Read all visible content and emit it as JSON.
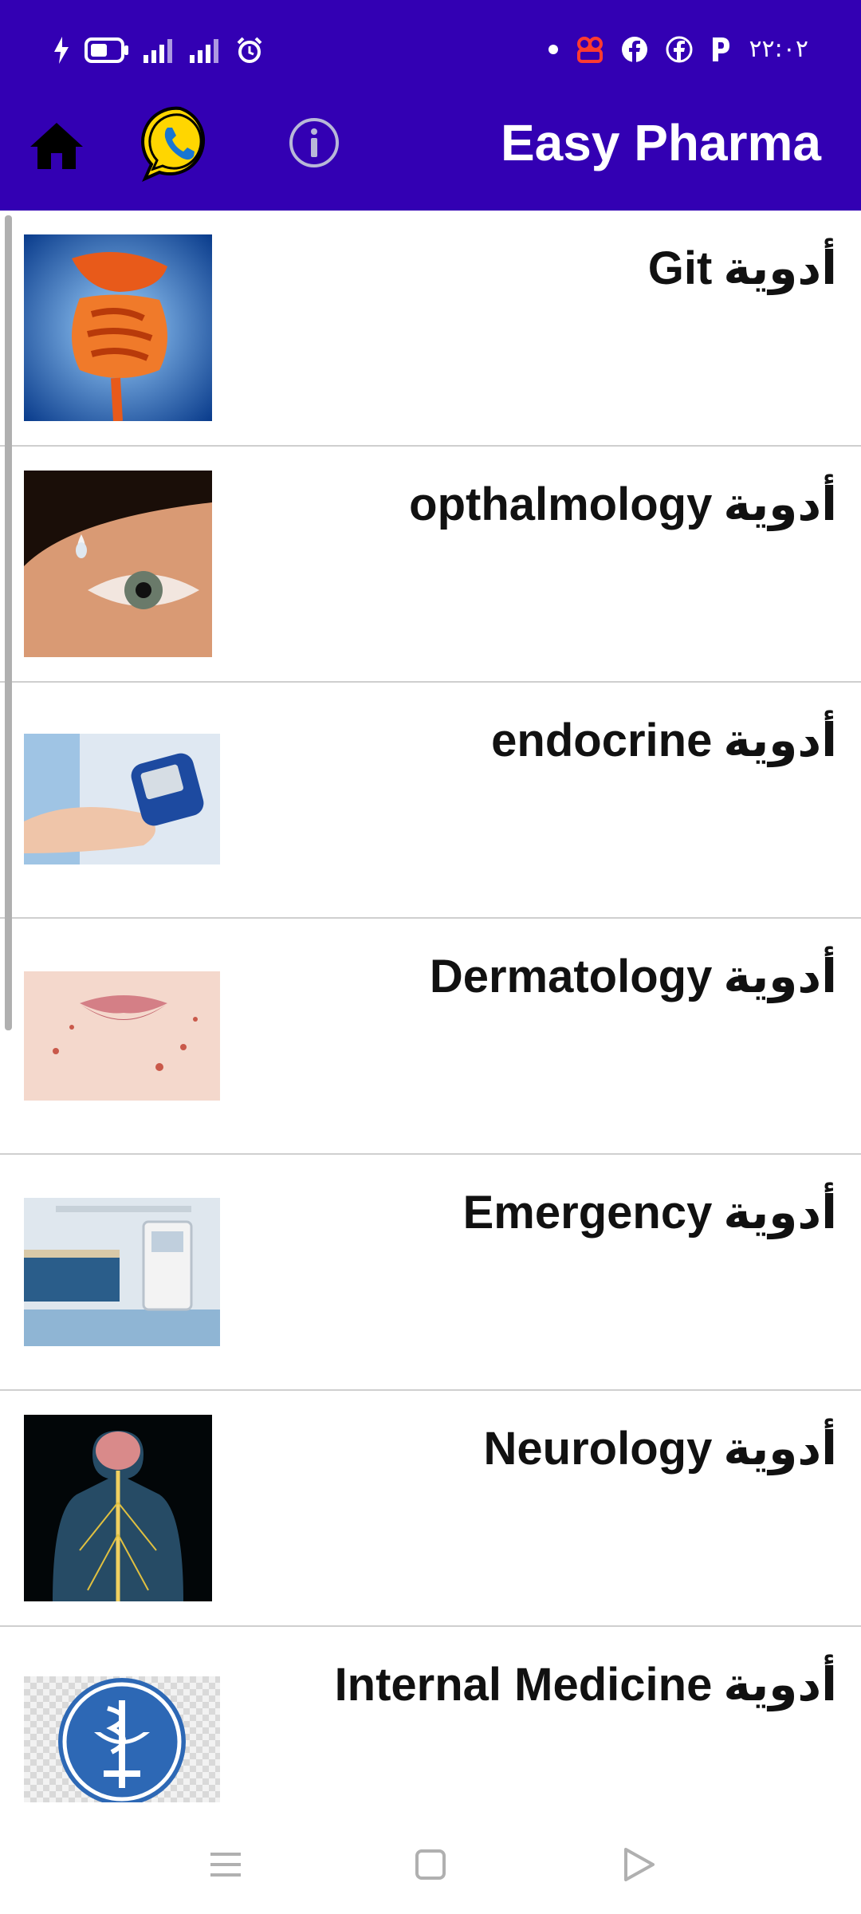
{
  "status_bar": {
    "time": "٢٢:٠٢"
  },
  "app": {
    "title": "Easy Pharma"
  },
  "categories": [
    {
      "name": "Git",
      "prefix": "أدوية"
    },
    {
      "name": "opthalmology",
      "prefix": "أدوية"
    },
    {
      "name": "endocrine",
      "prefix": "أدوية"
    },
    {
      "name": "Dermatology",
      "prefix": "أدوية"
    },
    {
      "name": "Emergency",
      "prefix": "أدوية"
    },
    {
      "name": "Neurology",
      "prefix": "أدوية"
    },
    {
      "name": "Internal Medicine",
      "prefix": "أدوية"
    }
  ],
  "icons": {
    "home": "home-icon",
    "whatsapp": "whatsapp-icon",
    "info": "info-icon",
    "nav_menu": "menu-icon",
    "nav_home": "square-icon",
    "nav_back": "back-triangle-icon"
  },
  "colors": {
    "primary": "#3300b3",
    "accent": "#ffd600"
  }
}
